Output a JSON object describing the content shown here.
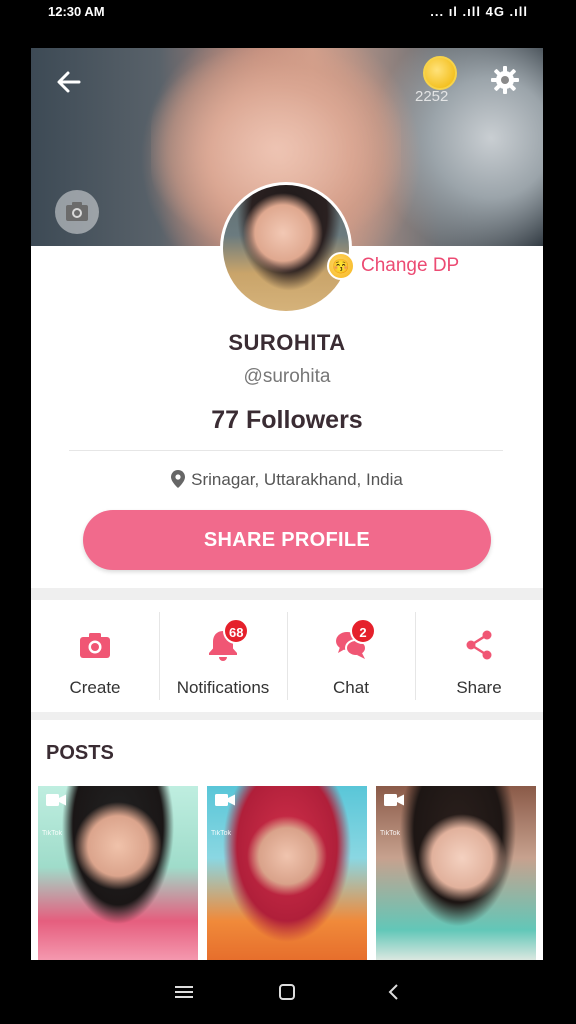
{
  "status_bar": {
    "time": "12:30 AM",
    "network": "... ıl .ıll 4G .ıll"
  },
  "header": {
    "coin_count": "2252"
  },
  "profile": {
    "change_dp_label": "Change DP",
    "name": "SUROHITA",
    "handle": "@surohita",
    "followers": "77 Followers",
    "location": "Srinagar, Uttarakhand, India",
    "share_profile_label": "SHARE PROFILE"
  },
  "actions": [
    {
      "label": "Create",
      "icon": "camera-icon"
    },
    {
      "label": "Notifications",
      "icon": "bell-icon",
      "badge": "68"
    },
    {
      "label": "Chat",
      "icon": "chat-icon",
      "badge": "2"
    },
    {
      "label": "Share",
      "icon": "share-icon"
    }
  ],
  "posts": {
    "title": "POSTS",
    "items": [
      {
        "watermark": "TikTok",
        "icon": "video-icon"
      },
      {
        "watermark": "TikTok",
        "icon": "video-icon"
      },
      {
        "watermark": "TikTok",
        "icon": "video-icon"
      }
    ]
  },
  "colors": {
    "accent": "#f16a8c",
    "accent_text": "#ec4b73",
    "badge": "#e5202b"
  }
}
